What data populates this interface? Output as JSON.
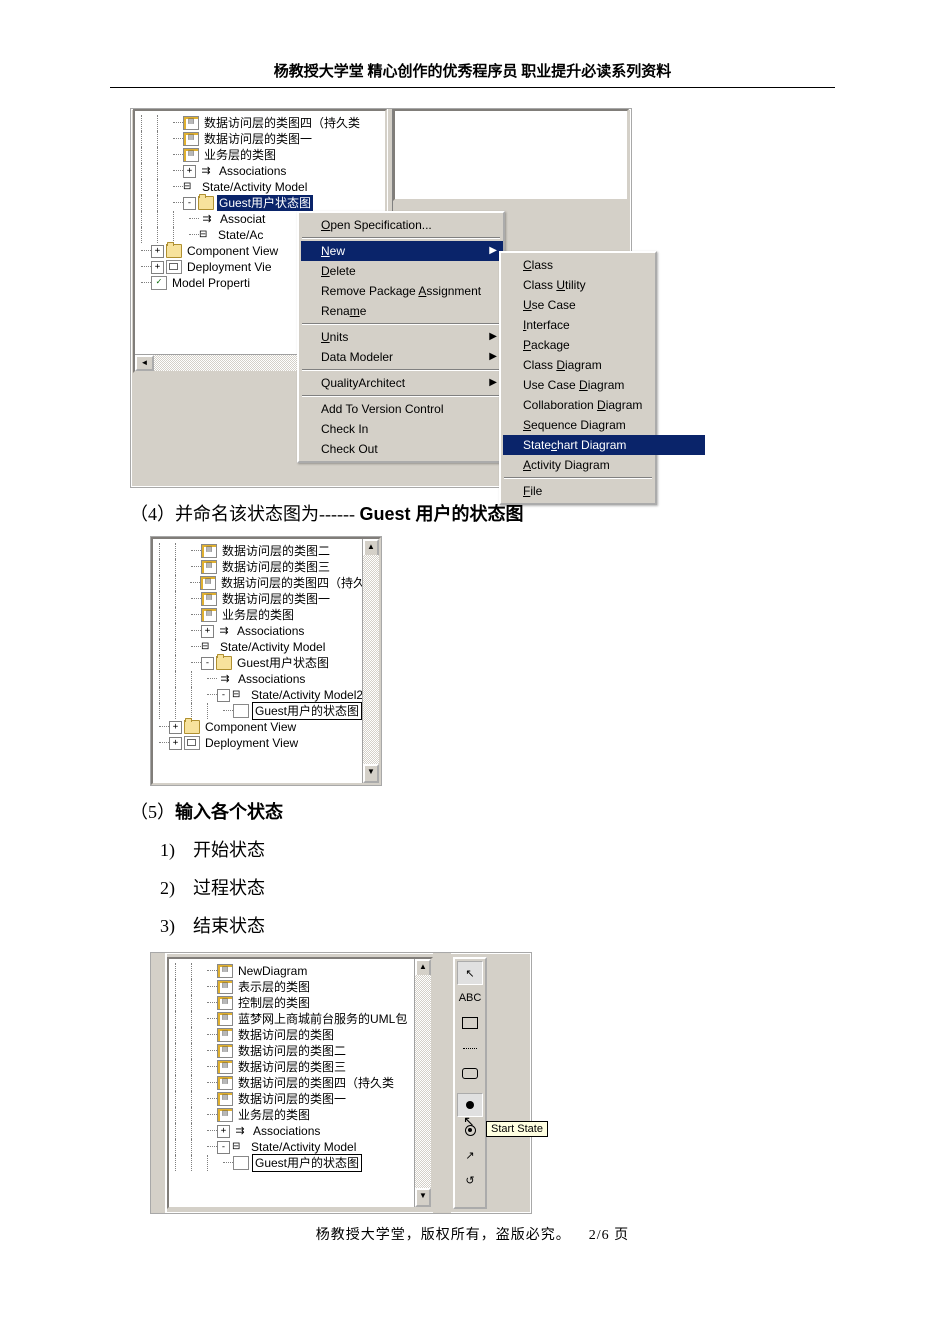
{
  "header": "杨教授大学堂 精心创作的优秀程序员 职业提升必读系列资料",
  "footer_text": "杨教授大学堂，版权所有，盗版必究。",
  "footer_page": "2/6 页",
  "shot1": {
    "tree": [
      {
        "indent": 2,
        "icon": "pg",
        "label": "数据访问层的类图四（持久类"
      },
      {
        "indent": 2,
        "icon": "pg",
        "label": "数据访问层的类图一"
      },
      {
        "indent": 2,
        "icon": "pg",
        "label": "业务层的类图"
      },
      {
        "indent": 2,
        "exp": "+",
        "icon": "as",
        "label": "Associations"
      },
      {
        "indent": 2,
        "icon": "sa",
        "label": "State/Activity Model"
      },
      {
        "indent": 2,
        "exp": "-",
        "icon": "fd",
        "label": "Guest用户状态图",
        "sel": true
      },
      {
        "indent": 3,
        "icon": "as",
        "label": "Associat"
      },
      {
        "indent": 3,
        "icon": "sa",
        "label": "State/Ac"
      },
      {
        "indent": 0,
        "exp": "+",
        "icon": "fd",
        "label": "Component View"
      },
      {
        "indent": 0,
        "exp": "+",
        "icon": "dp",
        "label": "Deployment Vie"
      },
      {
        "indent": 0,
        "icon": "mp",
        "label": "Model Properti"
      }
    ],
    "menu1": [
      {
        "t": "Open Specification...",
        "u": 0
      },
      {
        "sep": 1
      },
      {
        "t": "New",
        "u": 0,
        "sub": 1,
        "sel": 1
      },
      {
        "t": "Delete",
        "u": 0
      },
      {
        "t": "Remove Package Assignment",
        "u": 15
      },
      {
        "t": "Rename",
        "u": 4
      },
      {
        "sep": 1
      },
      {
        "t": "Units",
        "u": 0,
        "sub": 1
      },
      {
        "t": "Data Modeler",
        "sub": 1
      },
      {
        "sep": 1
      },
      {
        "t": "QualityArchitect",
        "sub": 1
      },
      {
        "sep": 1
      },
      {
        "t": "Add To Version Control"
      },
      {
        "t": "Check In"
      },
      {
        "t": "Check Out"
      }
    ],
    "menu2": [
      {
        "t": "Class",
        "u": 0
      },
      {
        "t": "Class Utility",
        "u": 6
      },
      {
        "t": "Use Case",
        "u": 0
      },
      {
        "t": "Interface",
        "u": 0
      },
      {
        "t": "Package",
        "u": 0
      },
      {
        "t": "Class Diagram",
        "u": 6
      },
      {
        "t": "Use Case Diagram",
        "u": 9
      },
      {
        "t": "Collaboration Diagram",
        "u": 14
      },
      {
        "t": "Sequence Diagram",
        "u": 0
      },
      {
        "t": "Statechart Diagram",
        "u": 5,
        "sel": 1
      },
      {
        "t": "Activity Diagram",
        "u": 0
      },
      {
        "sep": 1
      },
      {
        "t": "File",
        "u": 0
      }
    ]
  },
  "para4": {
    "num": "（4）",
    "text": "并命名该状态图为------ ",
    "bold": "Guest 用户的状态图"
  },
  "shot2": {
    "tree": [
      {
        "indent": 2,
        "icon": "pg",
        "label": "数据访问层的类图二"
      },
      {
        "indent": 2,
        "icon": "pg",
        "label": "数据访问层的类图三"
      },
      {
        "indent": 2,
        "icon": "pg",
        "label": "数据访问层的类图四（持久类"
      },
      {
        "indent": 2,
        "icon": "pg",
        "label": "数据访问层的类图一"
      },
      {
        "indent": 2,
        "icon": "pg",
        "label": "业务层的类图"
      },
      {
        "indent": 2,
        "exp": "+",
        "icon": "as",
        "label": "Associations"
      },
      {
        "indent": 2,
        "icon": "sa",
        "label": "State/Activity Model"
      },
      {
        "indent": 2,
        "exp": "-",
        "icon": "fd",
        "label": "Guest用户状态图"
      },
      {
        "indent": 3,
        "icon": "as",
        "label": "Associations"
      },
      {
        "indent": 3,
        "exp": "-",
        "icon": "sa",
        "label": "State/Activity Model2"
      },
      {
        "indent": 4,
        "icon": "sc",
        "label": "Guest用户的状态图",
        "box": 1
      },
      {
        "indent": 0,
        "exp": "+",
        "icon": "fd",
        "label": "Component View"
      },
      {
        "indent": 0,
        "exp": "+",
        "icon": "dp",
        "label": "Deployment View"
      }
    ]
  },
  "para5": {
    "num": "（5）",
    "text": "输入各个状态"
  },
  "list5": [
    "1)　开始状态",
    "2)　过程状态",
    "3)　结束状态"
  ],
  "shot3": {
    "tree": [
      {
        "indent": 2,
        "icon": "pg",
        "label": "NewDiagram"
      },
      {
        "indent": 2,
        "icon": "pg",
        "label": "表示层的类图"
      },
      {
        "indent": 2,
        "icon": "pg",
        "label": "控制层的类图"
      },
      {
        "indent": 2,
        "icon": "pg",
        "label": "蓝梦网上商城前台服务的UML包"
      },
      {
        "indent": 2,
        "icon": "pg",
        "label": "数据访问层的类图"
      },
      {
        "indent": 2,
        "icon": "pg",
        "label": "数据访问层的类图二"
      },
      {
        "indent": 2,
        "icon": "pg",
        "label": "数据访问层的类图三"
      },
      {
        "indent": 2,
        "icon": "pg",
        "label": "数据访问层的类图四（持久类"
      },
      {
        "indent": 2,
        "icon": "pg",
        "label": "数据访问层的类图一"
      },
      {
        "indent": 2,
        "icon": "pg",
        "label": "业务层的类图"
      },
      {
        "indent": 2,
        "exp": "+",
        "icon": "as",
        "label": "Associations"
      },
      {
        "indent": 2,
        "exp": "-",
        "icon": "sa",
        "label": "State/Activity Model"
      },
      {
        "indent": 3,
        "icon": "sc",
        "label": "Guest用户的状态图",
        "box": 1
      }
    ],
    "tooltip": "Start State",
    "tool_label": "ABC"
  }
}
